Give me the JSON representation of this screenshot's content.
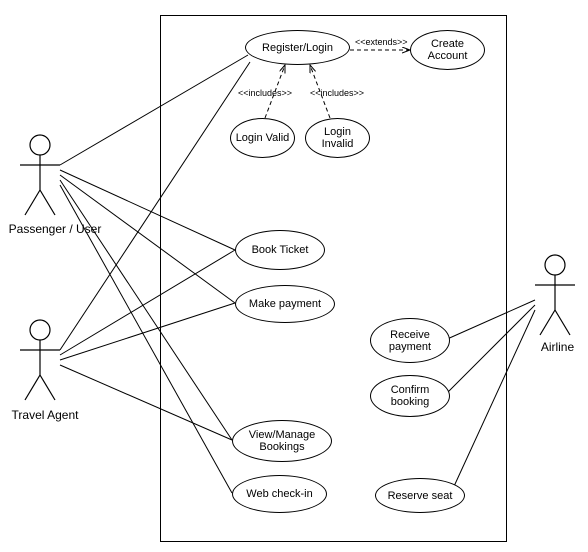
{
  "actors": {
    "passenger": "Passenger / User",
    "travel_agent": "Travel Agent",
    "airline": "Airline"
  },
  "usecases": {
    "register_login": "Register/Login",
    "create_account": "Create Account",
    "login_valid": "Login Valid",
    "login_invalid": "Login Invalid",
    "book_ticket": "Book Ticket",
    "make_payment": "Make payment",
    "receive_payment": "Receive payment",
    "confirm_booking": "Confirm booking",
    "view_manage": "View/Manage Bookings",
    "web_checkin": "Web check-in",
    "reserve_seat": "Reserve seat"
  },
  "relationships": {
    "extends": "<<extends>>",
    "includes1": "<<includes>>",
    "includes2": "<<includes>>"
  },
  "chart_data": {
    "type": "diagram",
    "diagram_type": "uml-use-case",
    "actors": [
      "Passenger / User",
      "Travel Agent",
      "Airline"
    ],
    "system_boundary": true,
    "use_cases": [
      "Register/Login",
      "Create Account",
      "Login Valid",
      "Login Invalid",
      "Book Ticket",
      "Make payment",
      "Receive payment",
      "Confirm booking",
      "View/Manage Bookings",
      "Web check-in",
      "Reserve seat"
    ],
    "associations": [
      {
        "actor": "Passenger / User",
        "usecase": "Register/Login"
      },
      {
        "actor": "Passenger / User",
        "usecase": "Book Ticket"
      },
      {
        "actor": "Passenger / User",
        "usecase": "Make payment"
      },
      {
        "actor": "Passenger / User",
        "usecase": "View/Manage Bookings"
      },
      {
        "actor": "Passenger / User",
        "usecase": "Web check-in"
      },
      {
        "actor": "Travel Agent",
        "usecase": "Register/Login"
      },
      {
        "actor": "Travel Agent",
        "usecase": "Book Ticket"
      },
      {
        "actor": "Travel Agent",
        "usecase": "Make payment"
      },
      {
        "actor": "Travel Agent",
        "usecase": "View/Manage Bookings"
      },
      {
        "actor": "Airline",
        "usecase": "Receive payment"
      },
      {
        "actor": "Airline",
        "usecase": "Confirm booking"
      },
      {
        "actor": "Airline",
        "usecase": "Reserve seat"
      }
    ],
    "dependencies": [
      {
        "from": "Register/Login",
        "to": "Create Account",
        "stereotype": "<<extends>>"
      },
      {
        "from": "Login Valid",
        "to": "Register/Login",
        "stereotype": "<<includes>>"
      },
      {
        "from": "Login Invalid",
        "to": "Register/Login",
        "stereotype": "<<includes>>"
      }
    ]
  }
}
